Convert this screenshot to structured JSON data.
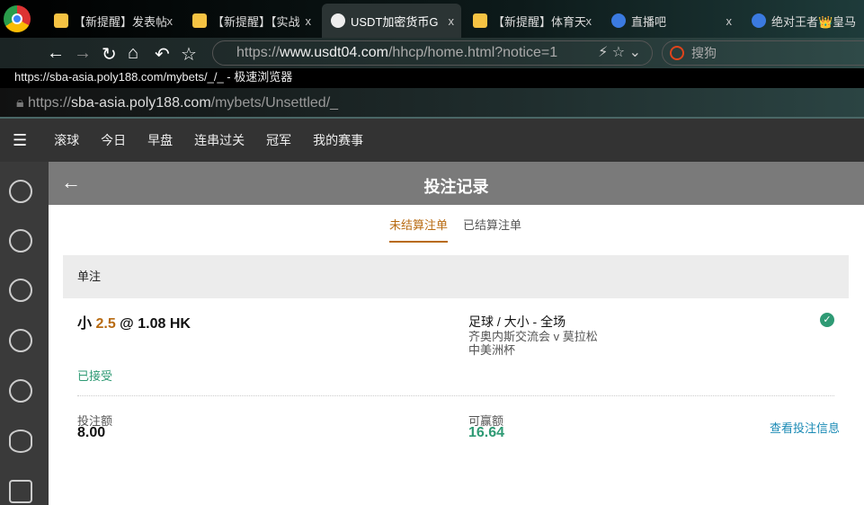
{
  "browser": {
    "tabs": [
      {
        "label": "【新提醒】发表帖",
        "icon": "notice-icon"
      },
      {
        "label": "【新提醒】【实战",
        "icon": "notice-icon"
      },
      {
        "label": "USDT加密货币G",
        "icon": "globe-icon",
        "active": true
      },
      {
        "label": "【新提醒】体育天",
        "icon": "notice-icon"
      },
      {
        "label": "直播吧",
        "icon": "8-icon"
      },
      {
        "label": "绝对王者👑皇马",
        "icon": "8-icon"
      }
    ],
    "close": "x",
    "url_scheme": "https://",
    "url_host": "www.usdt04.com",
    "url_path": "/hhcp/home.html?notice=1",
    "search_label": "搜狗"
  },
  "popup": {
    "title": "https://sba-asia.poly188.com/mybets/_/_ - 极速浏览器",
    "url_scheme": "https://",
    "url_host": "sba-asia.poly188.com",
    "url_path": "/mybets/Unsettled/_"
  },
  "nav": [
    "滚球",
    "今日",
    "早盘",
    "连串过关",
    "冠军",
    "我的赛事"
  ],
  "sidebar": [
    "soccer-icon",
    "basketball-icon",
    "tennis-icon",
    "volleyball-icon",
    "baseball-icon",
    "football-icon",
    "hockey-icon"
  ],
  "header": {
    "title": "投注记录",
    "back": "←"
  },
  "subtabs": [
    {
      "label": "未结算注单",
      "active": true
    },
    {
      "label": "已结算注单"
    }
  ],
  "section": "单注",
  "bet": {
    "selection": "小",
    "line": "2.5",
    "at": "@",
    "odds": "1.08 HK",
    "market": "足球 / 大小 - 全场",
    "match": "齐奥内斯交流会 v 莫拉松",
    "league": "中美洲杯",
    "status": "已接受",
    "stake_label": "投注额",
    "stake": "8.00",
    "win_label": "可赢额",
    "win": "16.64",
    "details_link": "查看投注信息"
  },
  "colors": {
    "accent": "#b86b12",
    "green": "#2e9a74",
    "link": "#1a8ab5"
  }
}
